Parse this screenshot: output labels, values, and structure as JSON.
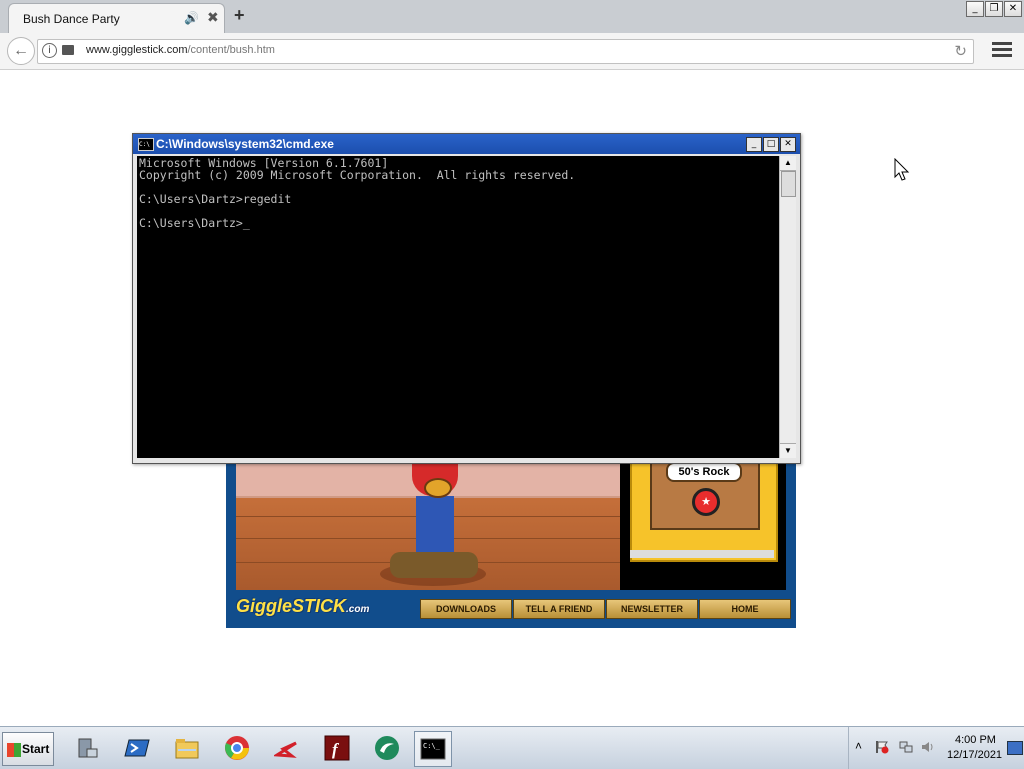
{
  "browser": {
    "tab_title": "Bush Dance Party",
    "tab_audio_icon": "speaker-icon",
    "tab_close": "✖",
    "new_tab": "+",
    "url_domain": "www.gigglestick.com",
    "url_path": "/content/bush.htm",
    "window_controls": [
      "_",
      "❐",
      "✕"
    ]
  },
  "game": {
    "jukebox_label": "50's Rock",
    "logo_main": "GiggleSTICK",
    "logo_suffix": ".com",
    "nav": [
      "DOWNLOADS",
      "TELL A FRIEND",
      "NEWSLETTER",
      "HOME"
    ]
  },
  "cmd": {
    "title": "C:\\Windows\\system32\\cmd.exe",
    "lines": "Microsoft Windows [Version 6.1.7601]\nCopyright (c) 2009 Microsoft Corporation.  All rights reserved.\n\nC:\\Users\\Dartz>regedit\n\nC:\\Users\\Dartz>_"
  },
  "taskbar": {
    "start_label": "Start",
    "apps": [
      "server-manager-icon",
      "powershell-icon",
      "explorer-icon",
      "chrome-icon",
      "acrobat-icon",
      "flash-icon",
      "app-icon",
      "cmd-icon"
    ],
    "clock_time": "4:00 PM",
    "clock_date": "12/17/2021"
  },
  "colors": {
    "cmd_title_bar": "#1c4fae",
    "cmd_background": "#000000",
    "cmd_text": "#c0c0c0",
    "game_blue": "#114d8c"
  }
}
